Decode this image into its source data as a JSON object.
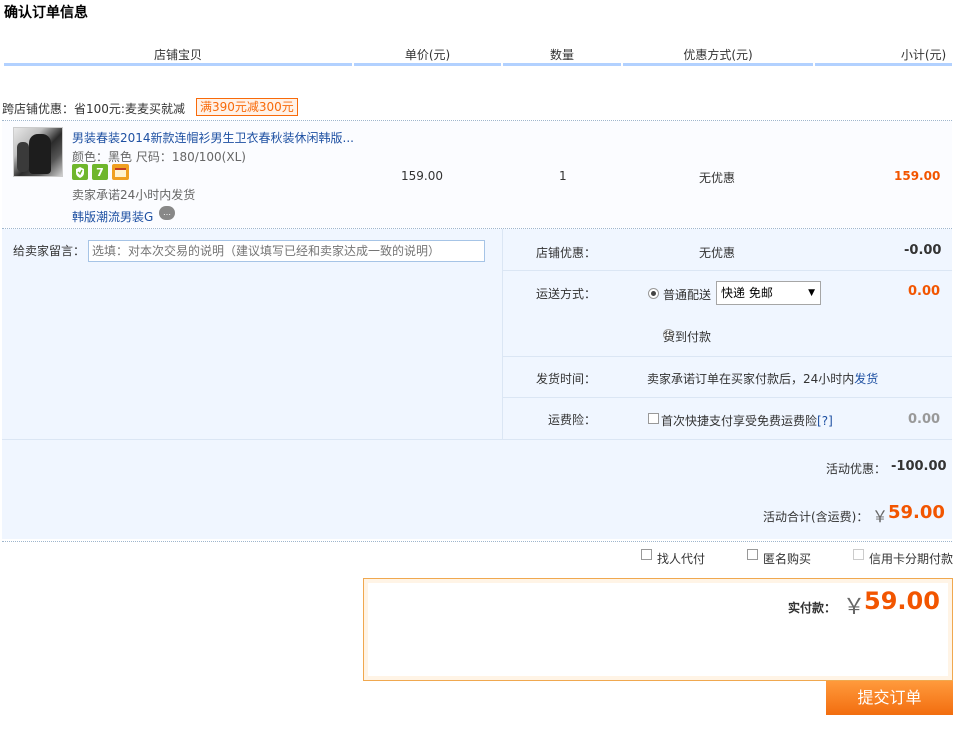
{
  "page": {
    "title": "确认订单信息"
  },
  "columns": [
    "店铺宝贝",
    "单价(元)",
    "数量",
    "优惠方式(元)",
    "小计(元)"
  ],
  "cross_store_promo": {
    "text": "跨店铺优惠：省100元:麦麦买就减",
    "badge": "满390元减300元"
  },
  "item": {
    "title": "男装春装2014新款连帽衫男生卫衣春秋装休闲韩版...",
    "sku": "颜色：黑色   尺码：180/100(XL)",
    "icon_7": "7",
    "ship_promise": "卖家承诺24小时内发货",
    "shop_name": "韩版潮流男装G",
    "unit_price": "159.00",
    "quantity": "1",
    "discount": "无优惠",
    "subtotal": "159.00"
  },
  "message": {
    "label": "给卖家留言：",
    "placeholder": "选填：对本次交易的说明（建议填写已经和卖家达成一致的说明）"
  },
  "store_discount": {
    "label": "店铺优惠：",
    "value": "无优惠",
    "amount": "-0.00"
  },
  "shipping": {
    "label": "运送方式：",
    "option_normal": "普通配送",
    "selected": "快递 免邮",
    "amount": "0.00",
    "option_cod": "货到付款"
  },
  "ship_time": {
    "label": "发货时间：",
    "text": "卖家承诺订单在买家付款后，24小时内",
    "link": "发货"
  },
  "insurance": {
    "label": "运费险：",
    "text": "首次快捷支付享受免费运费险",
    "help": "[?]",
    "amount": "0.00"
  },
  "summary": {
    "activity_label": "活动优惠：",
    "activity_amount": "-100.00",
    "total_label": "活动合计(含运费)：",
    "yen": "￥",
    "total": "59.00"
  },
  "extra_options": {
    "proxy_pay": "找人代付",
    "anonymous": "匿名购买",
    "installment": "信用卡分期付款"
  },
  "payment": {
    "label": "实付款：",
    "yen": "￥",
    "total": "59.00"
  },
  "submit": {
    "label": "提交订单"
  },
  "colors": {
    "accent": "#f25500",
    "link": "#1e50a2",
    "panel": "#f0f6ff"
  }
}
